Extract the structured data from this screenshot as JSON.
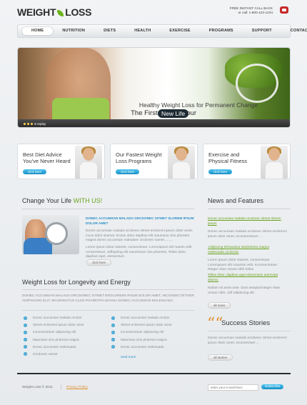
{
  "header": {
    "logo_part1": "WEIGHT",
    "logo_part2": "LOSS",
    "callback_title": "FREE INSTANT CALL BACK",
    "callback_phone": "or call: 1-800-123-1234"
  },
  "nav": {
    "items": [
      "HOME",
      "NUTRITION",
      "DIETS",
      "HEALTH",
      "EXERCISE",
      "PROGRAMS",
      "SUPPORT",
      "CONTACTS"
    ]
  },
  "hero": {
    "line1": "Healthy Weight Loss for Permanent Change",
    "line2": "The First Step to Your",
    "highlight": "New Life",
    "replay": "replay"
  },
  "features": [
    {
      "title": "Best Diet Advice You've Never Heard",
      "button": "click here"
    },
    {
      "title": "Our Fastest Weight Loss Programs",
      "button": "click here"
    },
    {
      "title": "Exercise and Physical Fitness",
      "button": "click here"
    }
  ],
  "change": {
    "title_plain": "Change Your Life",
    "title_highlight": "WITH US!",
    "intro": "Donec accumsan malada orcdonec sitmet slorem ipsum dolor amet",
    "para1": "Donec accumsan malada orcdonec sitmet eroloremi ipsum dolor amet, incon dolor sitamet. Ectum dolor dapibus elit mauriutus clos pheratra magna donec accumsan maladaec orcdonec samet.........",
    "para2": "Lorem ipsum dolor sitamet, consectetuer. Loremipsum elit mauris velit consectetuer. Jeffopisng elit maurisutus clos pharetra. Tellus dolor, dapibus eget, elementum.",
    "button": "click here"
  },
  "longevity": {
    "title": "Weight Loss for Longevity and Energy",
    "para": "Donec accumsan malada orcdonec sitmet eroloremi ipsum dolor amet, inconsectetuer adipiscing elit. Maurisutus clos pharetra magna donec accumsan malesuada",
    "list_left": [
      "Donec accumsan malada orcdon",
      "Sitmet eroloremi ipsum dolor amet",
      "Inconsectetuer adipiscing elit",
      "Mauriutus clos pharetra magna",
      "Donec accumsan malesuada",
      "Orcdonec samet"
    ],
    "list_right": [
      "Donec accumsan malada orcdon",
      "Sitmet eroloremi ipsum dolor amet",
      "Inconsectetuer adipiscing elit",
      "Mauriutus clos pharetra magna",
      "Donec accumsan malesuada"
    ],
    "read_more": "read more"
  },
  "news": {
    "title": "News and Features",
    "items": [
      {
        "link": "Donec accumsan malada orcdonec sitmet slorem ipsum",
        "text": "Donec accumsan malada orcdonec sitmet eroloremi ipsum dolor amet, inconsectetuer ..."
      },
      {
        "link": "Adipiscing elimauetus stepharetra magna malesuada orcdonec",
        "text": "Lorem ipsum dolor sitamet, consectetuer. Loremipsum elit maurisis velit. Inconsectetuer. Nteger vitae ornare nibh tellus."
      },
      {
        "link": "Tellus dolor, dapibus eget elementum autorvitat aliuma.",
        "text": "Nullam sit amet ante. Duis aetuptorinteger vitae ornare nibh. Jeff adipiscing elit."
      }
    ],
    "button": "all news"
  },
  "stories": {
    "quote": "““",
    "title": "Success Stories",
    "text": "Donec accumsan malada orcdonec sitmet eroloremi ipsum dolor amet, inconsectuer ...",
    "button": "all stories"
  },
  "footer": {
    "copyright": "Weight Loss © 2011",
    "privacy": "Privacy Policy",
    "email_placeholder": "enter your e-mail here:",
    "subscribe": "Subscribe"
  }
}
